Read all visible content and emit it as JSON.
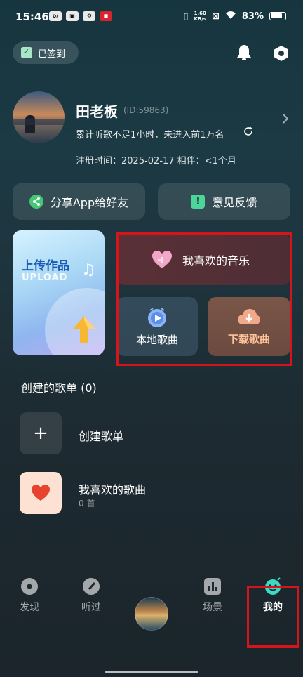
{
  "status_bar": {
    "time": "15:46",
    "net_speed_value": "1.60",
    "net_speed_unit": "KB/s",
    "battery": "83%"
  },
  "header": {
    "checkin_label": "已签到"
  },
  "profile": {
    "name": "田老板",
    "id_text": "(ID:59863)",
    "status_text": "累计听歌不足1小时，未进入前1万名",
    "registration_text": "注册时间：2025-02-17  相伴：<1个月"
  },
  "actions": {
    "share_label": "分享App给好友",
    "feedback_label": "意见反馈"
  },
  "upload": {
    "title": "上传作品",
    "subtitle": "UPLOAD"
  },
  "library": {
    "favorite_music": "我喜欢的音乐",
    "local_songs": "本地歌曲",
    "download_songs": "下载歌曲"
  },
  "playlists": {
    "section_title": "创建的歌单 (0)",
    "create_label": "创建歌单",
    "favorite_name": "我喜欢的歌曲",
    "favorite_count": "0 首"
  },
  "nav": {
    "discover": "发现",
    "history": "听过",
    "scene": "场景",
    "mine": "我的"
  },
  "colors": {
    "highlight_box": "#d6141c",
    "download_accent": "#ffc39a",
    "share_green": "#46c774"
  }
}
